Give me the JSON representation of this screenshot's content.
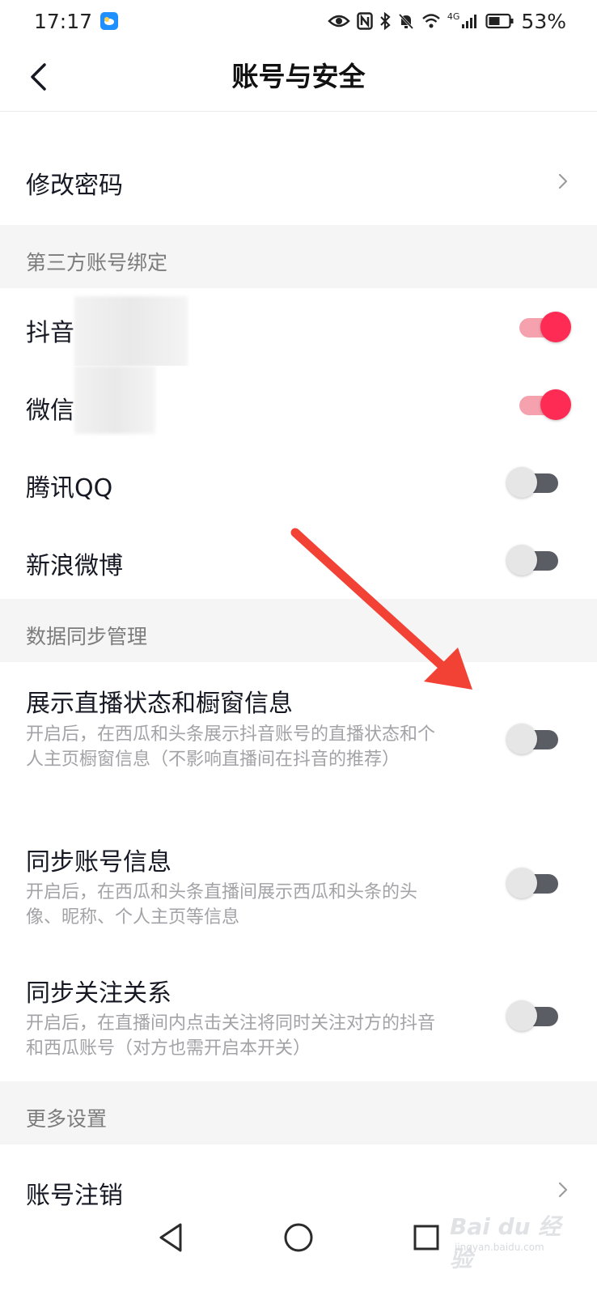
{
  "status_bar": {
    "time": "17:17",
    "battery": "53%",
    "network": "4G",
    "icons": [
      "weather-icon",
      "eye-icon",
      "nfc-icon",
      "bluetooth-icon",
      "mute-icon",
      "wifi-icon",
      "signal-icon",
      "battery-icon"
    ]
  },
  "nav": {
    "title": "账号与安全",
    "back_icon": "back-arrow-icon"
  },
  "rows": {
    "change_password": "修改密码",
    "account_cancel": "账号注销"
  },
  "sections": {
    "third_party": "第三方账号绑定",
    "data_sync": "数据同步管理",
    "more": "更多设置"
  },
  "bindings": [
    {
      "label": "抖音",
      "enabled": true
    },
    {
      "label": "微信",
      "enabled": true
    },
    {
      "label": "腾讯QQ",
      "enabled": false
    },
    {
      "label": "新浪微博",
      "enabled": false
    }
  ],
  "sync": [
    {
      "label": "展示直播状态和橱窗信息",
      "desc": "开启后，在西瓜和头条展示抖音账号的直播状态和个人主页橱窗信息（不影响直播间在抖音的推荐）",
      "enabled": false
    },
    {
      "label": "同步账号信息",
      "desc": "开启后，在西瓜和头条直播间展示西瓜和头条的头像、昵称、个人主页等信息",
      "enabled": false
    },
    {
      "label": "同步关注关系",
      "desc": "开启后，在直播间内点击关注将同时关注对方的抖音和西瓜账号（对方也需开启本开关）",
      "enabled": false
    }
  ],
  "colors": {
    "accent": "#fe2c55",
    "accent_track": "#f5a2ae",
    "off_track": "#5b5d64",
    "section_bg": "#f5f5f5",
    "annotation_arrow": "#f24236"
  },
  "watermark": {
    "main": "Bai du 经验",
    "sub": "jingyan.baidu.com"
  }
}
